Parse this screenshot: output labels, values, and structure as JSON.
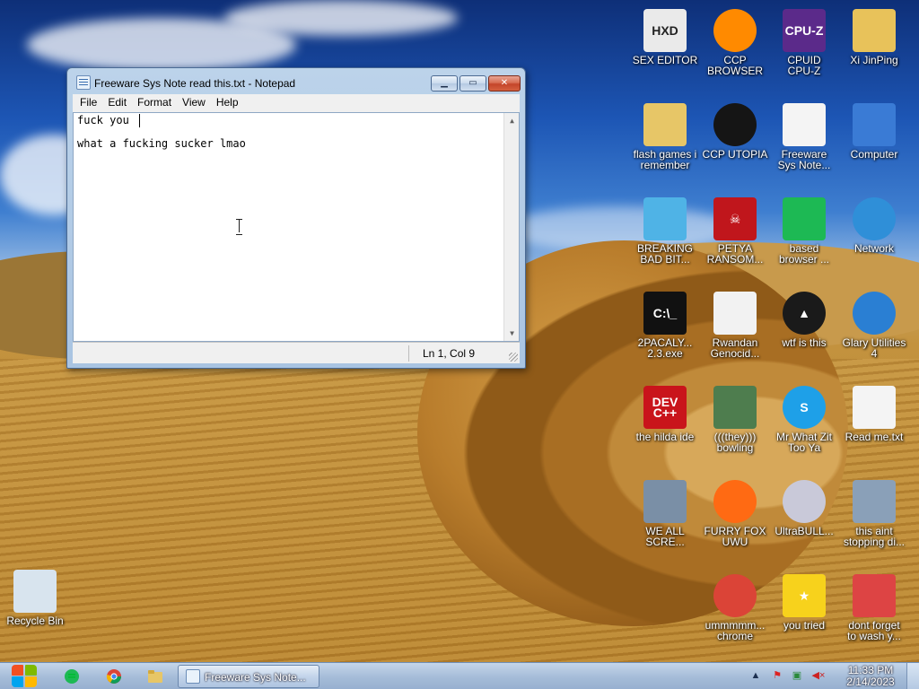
{
  "desktop": {
    "icons": [
      {
        "label": "SEX EDITOR",
        "icon": "hxd-hex-editor-icon",
        "glyph": "HXD",
        "color": "#eaeaea"
      },
      {
        "label": "CCP\nBROWSER",
        "icon": "browser-swirl-icon",
        "glyph": "",
        "color": "#ff8a00"
      },
      {
        "label": "CPUID\nCPU-Z",
        "icon": "cpu-z-icon",
        "glyph": "CPU-Z",
        "color": "#5b2a8a"
      },
      {
        "label": "Xi JinPing",
        "icon": "user-folder-icon",
        "glyph": "",
        "color": "#e8c25a"
      },
      {
        "label": "flash games i\nremember",
        "icon": "folder-icon",
        "glyph": "",
        "color": "#e7c667"
      },
      {
        "label": "CCP UTOPIA",
        "icon": "dark-emblem-icon",
        "glyph": "",
        "color": "#151515"
      },
      {
        "label": "Freeware\nSys Note...",
        "icon": "text-file-icon",
        "glyph": "",
        "color": "#f4f4f4"
      },
      {
        "label": "Computer",
        "icon": "computer-icon",
        "glyph": "",
        "color": "#3a7bd5"
      },
      {
        "label": "BREAKING\nBAD BIT...",
        "icon": "angry-birds-icon",
        "glyph": "",
        "color": "#4fb3e6"
      },
      {
        "label": "PETYA\nRANSOM...",
        "icon": "skull-icon",
        "glyph": "☠",
        "color": "#c0161c"
      },
      {
        "label": "based\nbrowser ...",
        "icon": "chat-icon",
        "glyph": "",
        "color": "#1db954"
      },
      {
        "label": "Network",
        "icon": "network-globe-icon",
        "glyph": "",
        "color": "#2f8fd8"
      },
      {
        "label": "2PACALY...\n2.3.exe",
        "icon": "console-icon",
        "glyph": "C:\\_",
        "color": "#111111"
      },
      {
        "label": "Rwandan\nGenocid...",
        "icon": "meme-face-icon",
        "glyph": "",
        "color": "#f2f2f2"
      },
      {
        "label": "wtf is this",
        "icon": "aimp-icon",
        "glyph": "▲",
        "color": "#1a1a1a"
      },
      {
        "label": "Glary Utilities\n4",
        "icon": "glary-moon-icon",
        "glyph": "",
        "color": "#2a7fd3"
      },
      {
        "label": "the hilda ide",
        "icon": "dev-cpp-icon",
        "glyph": "DEV\nC++",
        "color": "#c9141b"
      },
      {
        "label": "(((they)))\nbowling",
        "icon": "santa-icon",
        "glyph": "",
        "color": "#4e7d4e"
      },
      {
        "label": "Mr What Zit\nToo Ya",
        "icon": "skype-icon",
        "glyph": "S",
        "color": "#1ea0e8"
      },
      {
        "label": "Read me.txt",
        "icon": "text-file-icon",
        "glyph": "",
        "color": "#f4f4f4"
      },
      {
        "label": "WE ALL\nSCRE...",
        "icon": "computer-virus-icon",
        "glyph": "",
        "color": "#7a8fa6"
      },
      {
        "label": "FURRY FOX\nUWU",
        "icon": "firefox-icon",
        "glyph": "",
        "color": "#ff6a13"
      },
      {
        "label": "UltraBULL...",
        "icon": "disc-icon",
        "glyph": "",
        "color": "#c9c9d9"
      },
      {
        "label": "this aint\nstopping di...",
        "icon": "computer-install-icon",
        "glyph": "",
        "color": "#8aa0b8"
      },
      {
        "label": "Recycle Bin",
        "icon": "recycle-bin-icon",
        "glyph": "",
        "color": "#d8e4ee"
      },
      {
        "label": "ummmmm...\nchrome",
        "icon": "chrome-icon",
        "glyph": "",
        "color": "#db4437"
      },
      {
        "label": "you tried",
        "icon": "star-icon",
        "glyph": "★",
        "color": "#f7d21c"
      },
      {
        "label": "dont forget\nto wash y...",
        "icon": "ccleaner-icon",
        "glyph": "",
        "color": "#d44"
      }
    ]
  },
  "notepad": {
    "title": "Freeware Sys Note read this.txt - Notepad",
    "menu": [
      "File",
      "Edit",
      "Format",
      "View",
      "Help"
    ],
    "lines": [
      "fuck you",
      "",
      "what a fucking sucker lmao"
    ],
    "status": "Ln 1, Col 9"
  },
  "taskbar": {
    "task_title": "Freeware Sys Note...",
    "clock_time": "11:33 PM",
    "clock_date": "2/14/2023"
  },
  "colors": {
    "accent": "#3a6fb0",
    "close_button": "#c4452a",
    "taskbar": "#a5bcd8"
  }
}
